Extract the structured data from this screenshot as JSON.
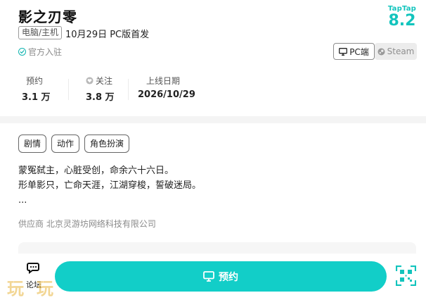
{
  "game": {
    "title": "影之刃零",
    "platform_badge": "电脑/主机",
    "release_text": "10月29日 PC版首发",
    "official_text": "官方入驻"
  },
  "rating": {
    "brand": "TapTap",
    "score": "8.2",
    "color": "#12c4bd"
  },
  "platforms": {
    "pc_label": "PC端",
    "steam_label": "Steam"
  },
  "stats": {
    "reserve_label": "预约",
    "reserve_value": "3.1 万",
    "follow_label": "关注",
    "follow_value": "3.8 万",
    "launch_label": "上线日期",
    "launch_value": "2026/10/29"
  },
  "tags": [
    "剧情",
    "动作",
    "角色扮演"
  ],
  "description": {
    "line1": "蒙冤弑主，心脏受创，命余六十六日。",
    "line2": "形单影只，亡命天涯，江湖穿梭，誓破迷局。",
    "more": "..."
  },
  "supplier": "供应商 北京灵游坊网络科技有限公司",
  "bottom": {
    "forum_label": "论坛",
    "reserve_button": "预约",
    "accent_color": "#12cec8"
  },
  "watermark": "玩玩"
}
